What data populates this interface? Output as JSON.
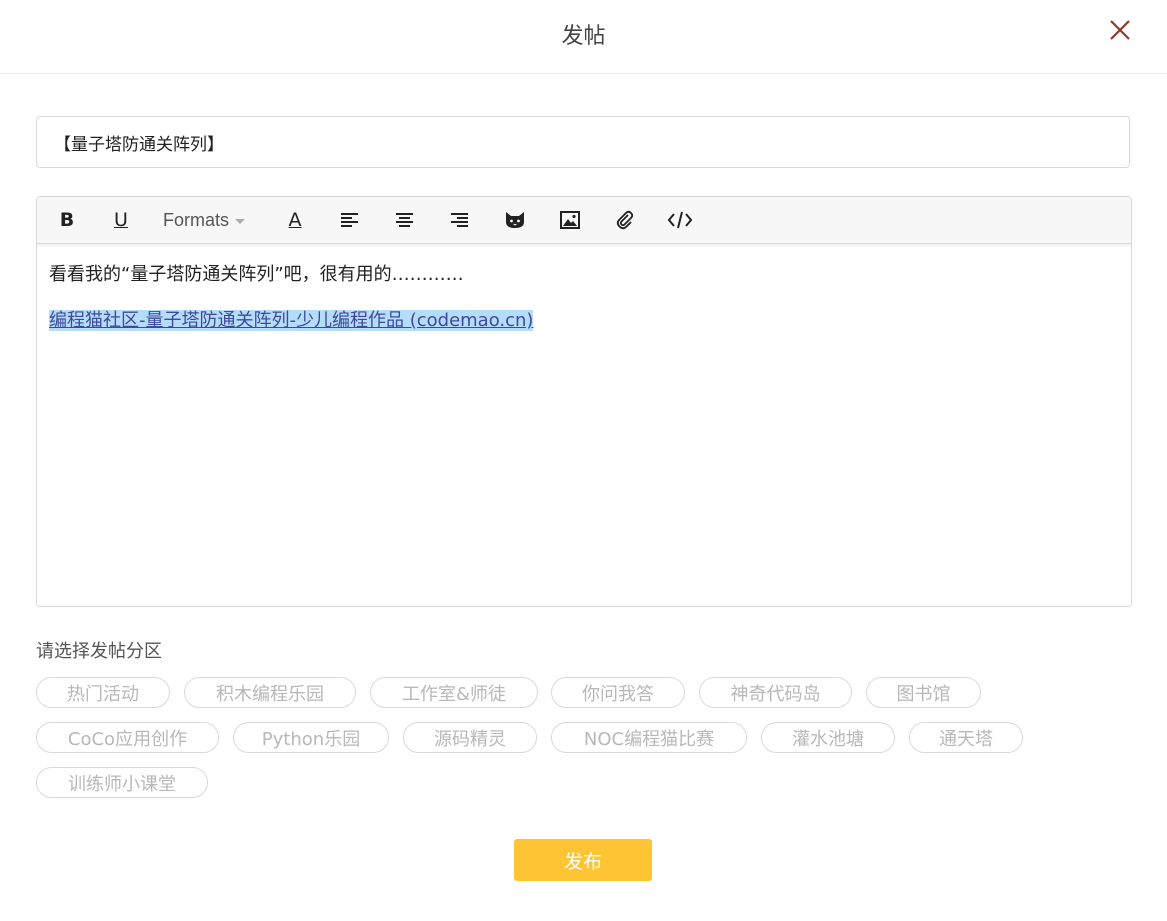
{
  "header": {
    "title": "发帖",
    "close_icon": "close-icon",
    "close_color": "#8b3a2b"
  },
  "post": {
    "title_value": "【量子塔防通关阵列】",
    "body_text": "看看我的“量子塔防通关阵列”吧，很有用的…………",
    "link_text": "编程猫社区-量子塔防通关阵列-少儿编程作品 (codemao.cn)"
  },
  "toolbar": {
    "bold": "B",
    "underline": "U",
    "formats": "Formats",
    "font_color": "A",
    "icons": [
      "bold-icon",
      "underline-icon",
      "font-color-icon",
      "align-left-icon",
      "align-center-icon",
      "align-right-icon",
      "cat-emoji-icon",
      "image-icon",
      "attachment-icon",
      "code-icon"
    ]
  },
  "section": {
    "label": "请选择发帖分区",
    "tags": [
      "热门活动",
      "积木编程乐园",
      "工作室&师徒",
      "你问我答",
      "神奇代码岛",
      "图书馆",
      "CoCo应用创作",
      "Python乐园",
      "源码精灵",
      "NOC编程猫比赛",
      "灌水池塘",
      "通天塔",
      "训练师小课堂"
    ]
  },
  "actions": {
    "publish": "发布"
  },
  "colors": {
    "accent": "#fec433",
    "link_bg": "#b5dcfb",
    "link_text": "#3d4a9c"
  }
}
